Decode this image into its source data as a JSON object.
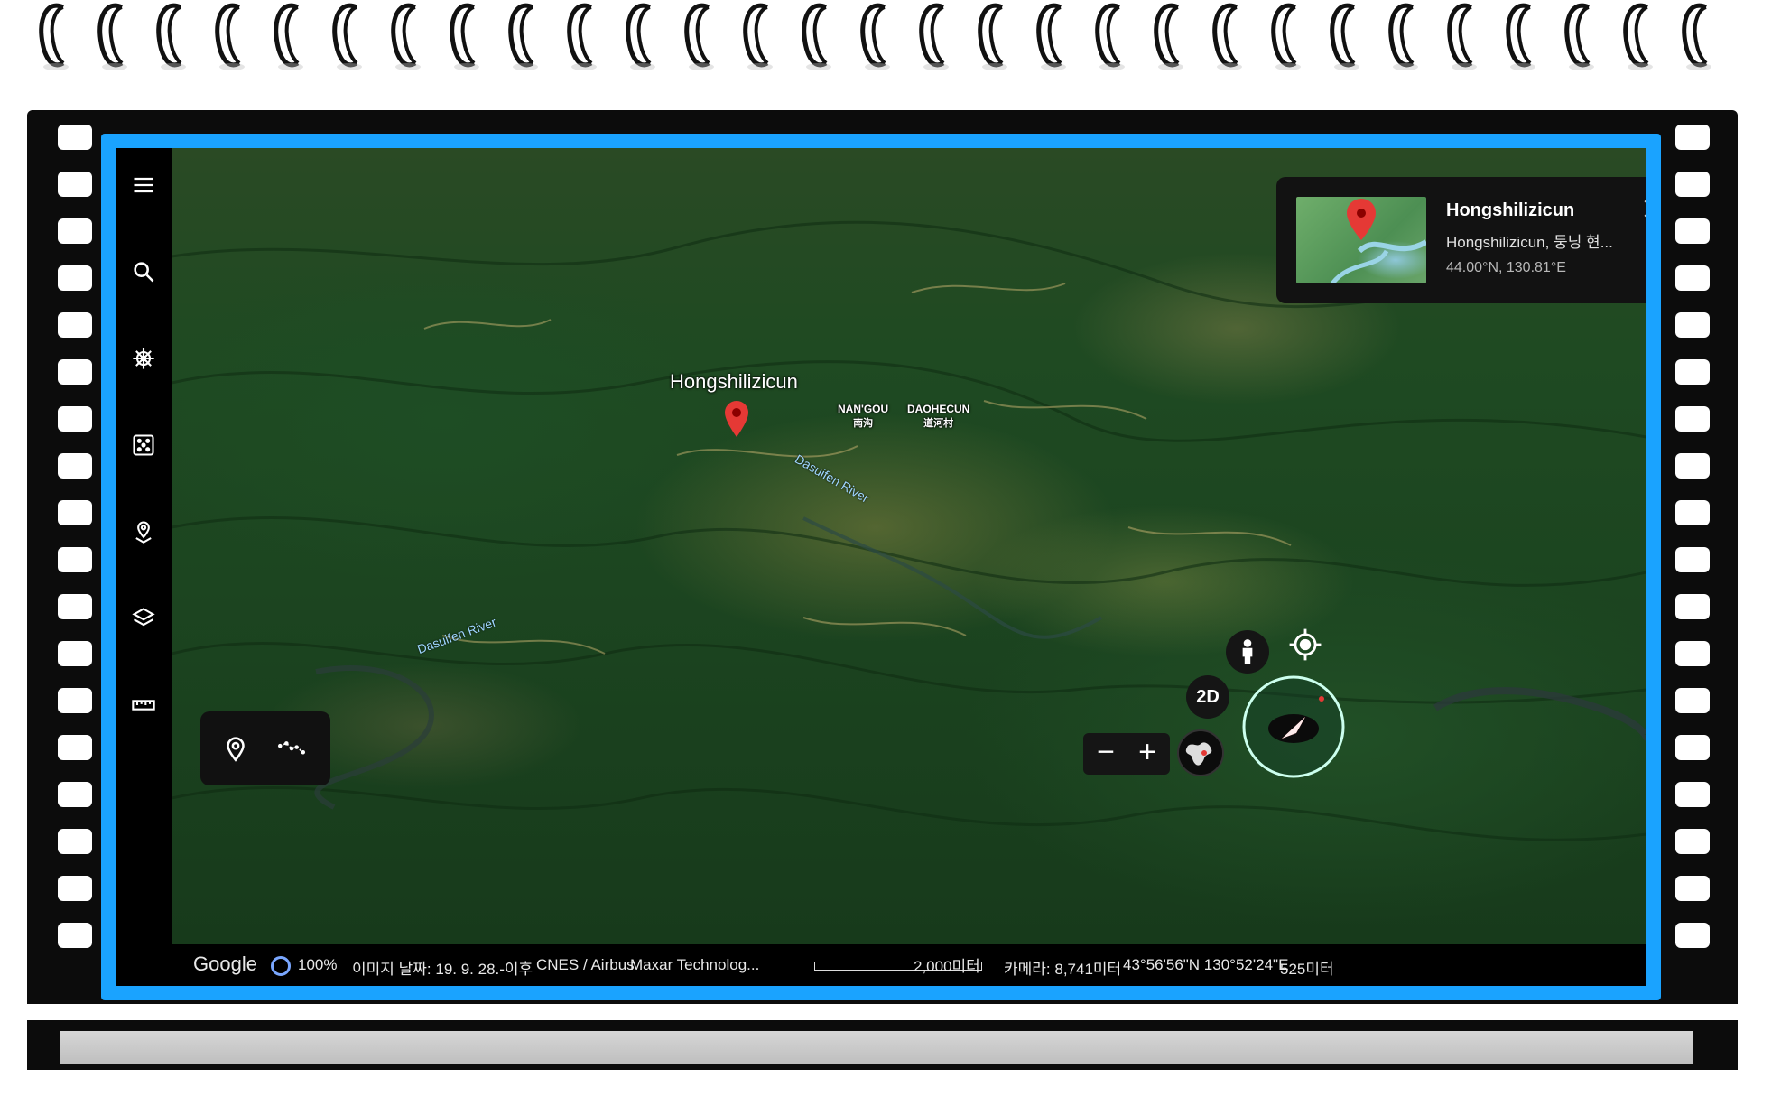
{
  "card": {
    "title": "Hongshilizicun",
    "subtitle": "Hongshilizicun, 둥닝 현...",
    "coords": "44.00°N, 130.81°E"
  },
  "map": {
    "place_label": "Hongshilizicun",
    "village1_en": "NAN'GOU",
    "village1_cn": "南沟",
    "village2_en": "DAOHECUN",
    "village2_cn": "道河村",
    "river1": "Dasuifen River",
    "river2": "Dasuifen River"
  },
  "controls": {
    "mode_2d": "2D",
    "zoom_out": "−",
    "zoom_in": "+"
  },
  "status": {
    "logo": "Google",
    "load_percent": "100%",
    "image_date": "이미지 날짜: 19. 9. 28.-이후",
    "attribution1": "CNES / Airbus",
    "attribution2": "Maxar Technolog...",
    "scale": "2,000미터",
    "camera": "카메라: 8,741미터",
    "coords": "43°56'56\"N 130°52'24\"E",
    "elevation": "525미터"
  },
  "colors": {
    "frame_blue": "#1aa3ff",
    "pin_red": "#e53935",
    "panel": "#121212"
  }
}
